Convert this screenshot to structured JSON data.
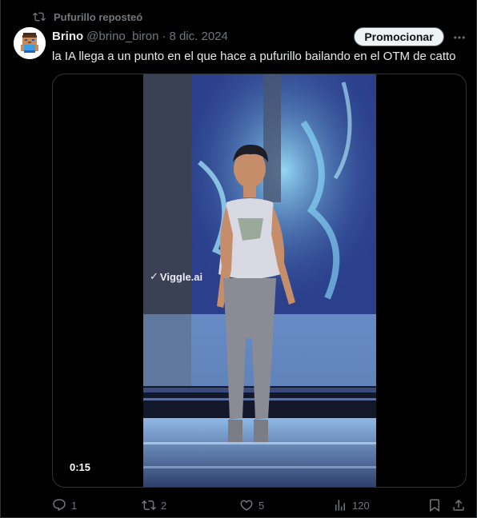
{
  "repost": {
    "text": "Pufurillo reposteó",
    "icon": "repost-icon"
  },
  "tweet": {
    "author_name": "Brino",
    "author_handle": "@brino_biron",
    "separator": "·",
    "date": "8 dic. 2024",
    "text": "la IA llega a un punto en el que hace a pufurillo bailando en el OTM de catto",
    "promote_label": "Promocionar",
    "more_icon": "more-icon"
  },
  "media": {
    "duration": "0:15",
    "watermark": "Viggle.ai"
  },
  "actions": {
    "replies": "1",
    "reposts": "2",
    "likes": "5",
    "views": "120"
  },
  "colors": {
    "background": "#000000",
    "text_primary": "#e7e9ea",
    "text_secondary": "#71767b",
    "border": "#2f3336",
    "promote_bg": "#eff3f4"
  }
}
